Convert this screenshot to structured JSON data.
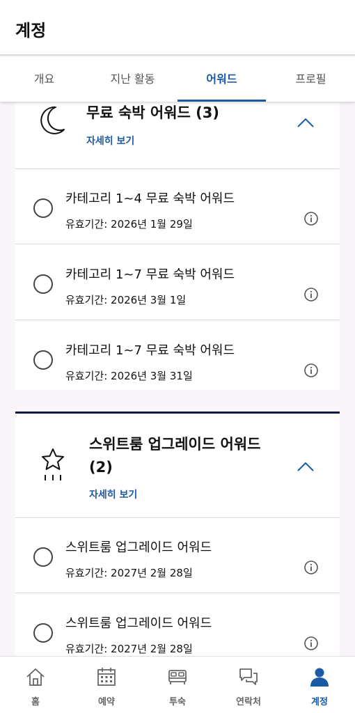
{
  "header": {
    "title": "계정"
  },
  "tabs": [
    {
      "label": "개요",
      "active": false
    },
    {
      "label": "지난 활동",
      "active": false
    },
    {
      "label": "어워드",
      "active": true
    },
    {
      "label": "프로필",
      "active": false
    }
  ],
  "cards": [
    {
      "icon": "moon-icon",
      "title": "무료 숙박 어워드 (3)",
      "details_label": "자세히 보기",
      "expanded": true,
      "items": [
        {
          "title": "카테고리 1~4 무료 숙박 어워드",
          "validity": "유효기간: 2026년 1월 29일"
        },
        {
          "title": "카테고리 1~7 무료 숙박 어워드",
          "validity": "유효기간: 2026년 3월 1일"
        },
        {
          "title": "카테고리 1~7 무료 숙박 어워드",
          "validity": "유효기간: 2026년 3월 31일"
        }
      ]
    },
    {
      "icon": "star-upgrade-icon",
      "title_line1": "스위트룸 업그레이드 어워드",
      "title_line2": "(2)",
      "details_label": "자세히 보기",
      "expanded": true,
      "items": [
        {
          "title": "스위트룸 업그레이드 어워드",
          "validity": "유효기간: 2027년 2월 28일"
        },
        {
          "title": "스위트룸 업그레이드 어워드",
          "validity": "유효기간: 2027년 2월 28일"
        }
      ]
    }
  ],
  "bottom_nav": [
    {
      "label": "홈",
      "icon": "home-icon",
      "active": false
    },
    {
      "label": "예약",
      "icon": "calendar-icon",
      "active": false
    },
    {
      "label": "투숙",
      "icon": "bed-icon",
      "active": false
    },
    {
      "label": "연락처",
      "icon": "chat-icon",
      "active": false
    },
    {
      "label": "계정",
      "icon": "person-icon",
      "active": true
    }
  ],
  "colors": {
    "accent": "#1a5aa6",
    "navy": "#0f1a4a",
    "background": "#faf5fb"
  }
}
